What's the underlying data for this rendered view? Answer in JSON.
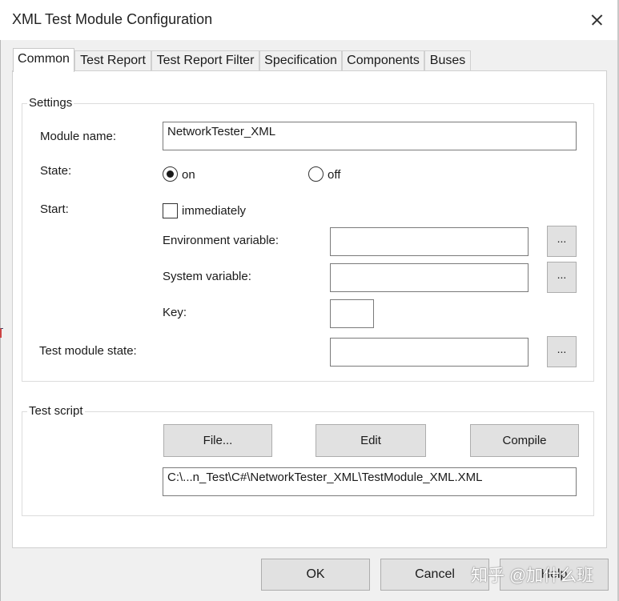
{
  "window": {
    "title": "XML Test Module Configuration"
  },
  "tabs": [
    {
      "label": "Common",
      "active": true
    },
    {
      "label": "Test Report"
    },
    {
      "label": "Test Report Filter"
    },
    {
      "label": "Specification"
    },
    {
      "label": "Components"
    },
    {
      "label": "Buses"
    }
  ],
  "settings": {
    "group_label": "Settings",
    "module_name_label": "Module name:",
    "module_name_value": "NetworkTester_XML",
    "state_label": "State:",
    "state_options": [
      {
        "label": "on",
        "selected": true
      },
      {
        "label": "off",
        "selected": false
      }
    ],
    "start_label": "Start:",
    "immediately_label": "immediately",
    "immediately_checked": false,
    "env_var_label": "Environment variable:",
    "env_var_value": "",
    "sys_var_label": "System variable:",
    "sys_var_value": "",
    "key_label": "Key:",
    "key_value": "",
    "test_module_state_label": "Test module state:",
    "test_module_state_value": "",
    "browse_label": "..."
  },
  "test_script": {
    "group_label": "Test script",
    "file_button": "File...",
    "edit_button": "Edit",
    "compile_button": "Compile",
    "path_value": "C:\\...n_Test\\C#\\NetworkTester_XML\\TestModule_XML.XML"
  },
  "footer": {
    "ok_label": "OK",
    "cancel_label": "Cancel",
    "help_label": "Help"
  },
  "watermark": "知乎 @加什么班",
  "colors": {
    "background": "#f0f0f0",
    "panel": "#ffffff",
    "button": "#e1e1e1",
    "border": "#adadad"
  }
}
